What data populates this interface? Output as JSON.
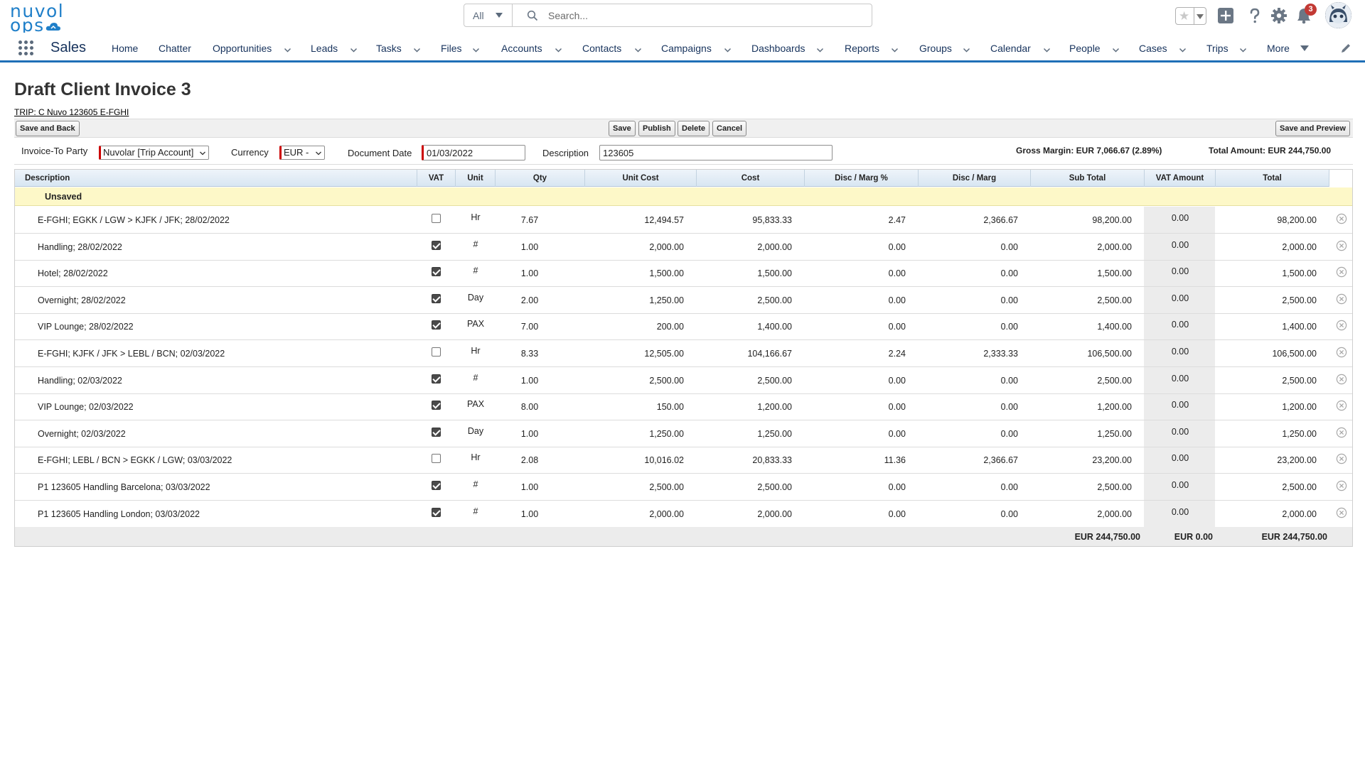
{
  "logo": {
    "line1": "nuvol",
    "line2": "ops"
  },
  "search": {
    "scope": "All",
    "placeholder": "Search..."
  },
  "notifications": {
    "count": "3"
  },
  "nav": {
    "app_name": "Sales",
    "items": [
      {
        "label": "Home",
        "dropdown": false
      },
      {
        "label": "Chatter",
        "dropdown": false
      },
      {
        "label": "Opportunities",
        "dropdown": true
      },
      {
        "label": "Leads",
        "dropdown": true
      },
      {
        "label": "Tasks",
        "dropdown": true
      },
      {
        "label": "Files",
        "dropdown": true
      },
      {
        "label": "Accounts",
        "dropdown": true
      },
      {
        "label": "Contacts",
        "dropdown": true
      },
      {
        "label": "Campaigns",
        "dropdown": true
      },
      {
        "label": "Dashboards",
        "dropdown": true
      },
      {
        "label": "Reports",
        "dropdown": true
      },
      {
        "label": "Groups",
        "dropdown": true
      },
      {
        "label": "Calendar",
        "dropdown": true
      },
      {
        "label": "People",
        "dropdown": true
      },
      {
        "label": "Cases",
        "dropdown": true
      },
      {
        "label": "Trips",
        "dropdown": true
      },
      {
        "label": "More",
        "dropdown": true
      }
    ]
  },
  "page": {
    "title": "Draft Client Invoice 3",
    "trip_link": "TRIP: C Nuvo 123605 E-FGHI"
  },
  "buttons": {
    "save_and_back": "Save and Back",
    "save": "Save",
    "publish": "Publish",
    "delete": "Delete",
    "cancel": "Cancel",
    "save_and_preview": "Save and Preview"
  },
  "fields": {
    "invoice_to_label": "Invoice-To Party",
    "invoice_to_value": "Nuvolar [Trip Account]",
    "currency_label": "Currency",
    "currency_value": "EUR -",
    "doc_date_label": "Document Date",
    "doc_date_value": "01/03/2022",
    "description_label": "Description",
    "description_value": "123605",
    "gross_margin": "Gross Margin: EUR 7,066.67 (2.89%)",
    "total_amount": "Total Amount: EUR 244,750.00"
  },
  "table": {
    "headers": [
      "Description",
      "VAT",
      "Unit",
      "Qty",
      "Unit Cost",
      "Cost",
      "Disc / Marg %",
      "Disc / Marg",
      "Sub Total",
      "VAT Amount",
      "Total"
    ],
    "group_label": "Unsaved",
    "rows": [
      {
        "desc": "E-FGHI; EGKK / LGW > KJFK / JFK; 28/02/2022",
        "vat": false,
        "unit": "Hr",
        "qty": "7.67",
        "unit_cost": "12,494.57",
        "cost": "95,833.33",
        "dm_pct": "2.47",
        "dm": "2,366.67",
        "sub": "98,200.00",
        "vat_amt": "0.00",
        "total": "98,200.00"
      },
      {
        "desc": "Handling; 28/02/2022",
        "vat": true,
        "unit": "#",
        "qty": "1.00",
        "unit_cost": "2,000.00",
        "cost": "2,000.00",
        "dm_pct": "0.00",
        "dm": "0.00",
        "sub": "2,000.00",
        "vat_amt": "0.00",
        "total": "2,000.00"
      },
      {
        "desc": "Hotel; 28/02/2022",
        "vat": true,
        "unit": "#",
        "qty": "1.00",
        "unit_cost": "1,500.00",
        "cost": "1,500.00",
        "dm_pct": "0.00",
        "dm": "0.00",
        "sub": "1,500.00",
        "vat_amt": "0.00",
        "total": "1,500.00"
      },
      {
        "desc": "Overnight; 28/02/2022",
        "vat": true,
        "unit": "Day",
        "qty": "2.00",
        "unit_cost": "1,250.00",
        "cost": "2,500.00",
        "dm_pct": "0.00",
        "dm": "0.00",
        "sub": "2,500.00",
        "vat_amt": "0.00",
        "total": "2,500.00"
      },
      {
        "desc": "VIP Lounge; 28/02/2022",
        "vat": true,
        "unit": "PAX",
        "qty": "7.00",
        "unit_cost": "200.00",
        "cost": "1,400.00",
        "dm_pct": "0.00",
        "dm": "0.00",
        "sub": "1,400.00",
        "vat_amt": "0.00",
        "total": "1,400.00"
      },
      {
        "desc": "E-FGHI; KJFK / JFK > LEBL / BCN; 02/03/2022",
        "vat": false,
        "unit": "Hr",
        "qty": "8.33",
        "unit_cost": "12,505.00",
        "cost": "104,166.67",
        "dm_pct": "2.24",
        "dm": "2,333.33",
        "sub": "106,500.00",
        "vat_amt": "0.00",
        "total": "106,500.00"
      },
      {
        "desc": "Handling; 02/03/2022",
        "vat": true,
        "unit": "#",
        "qty": "1.00",
        "unit_cost": "2,500.00",
        "cost": "2,500.00",
        "dm_pct": "0.00",
        "dm": "0.00",
        "sub": "2,500.00",
        "vat_amt": "0.00",
        "total": "2,500.00"
      },
      {
        "desc": "VIP Lounge; 02/03/2022",
        "vat": true,
        "unit": "PAX",
        "qty": "8.00",
        "unit_cost": "150.00",
        "cost": "1,200.00",
        "dm_pct": "0.00",
        "dm": "0.00",
        "sub": "1,200.00",
        "vat_amt": "0.00",
        "total": "1,200.00"
      },
      {
        "desc": "Overnight; 02/03/2022",
        "vat": true,
        "unit": "Day",
        "qty": "1.00",
        "unit_cost": "1,250.00",
        "cost": "1,250.00",
        "dm_pct": "0.00",
        "dm": "0.00",
        "sub": "1,250.00",
        "vat_amt": "0.00",
        "total": "1,250.00"
      },
      {
        "desc": "E-FGHI; LEBL / BCN > EGKK / LGW; 03/03/2022",
        "vat": false,
        "unit": "Hr",
        "qty": "2.08",
        "unit_cost": "10,016.02",
        "cost": "20,833.33",
        "dm_pct": "11.36",
        "dm": "2,366.67",
        "sub": "23,200.00",
        "vat_amt": "0.00",
        "total": "23,200.00"
      },
      {
        "desc": "P1 123605 Handling Barcelona; 03/03/2022",
        "vat": true,
        "unit": "#",
        "qty": "1.00",
        "unit_cost": "2,500.00",
        "cost": "2,500.00",
        "dm_pct": "0.00",
        "dm": "0.00",
        "sub": "2,500.00",
        "vat_amt": "0.00",
        "total": "2,500.00"
      },
      {
        "desc": "P1 123605 Handling London; 03/03/2022",
        "vat": true,
        "unit": "#",
        "qty": "1.00",
        "unit_cost": "2,000.00",
        "cost": "2,000.00",
        "dm_pct": "0.00",
        "dm": "0.00",
        "sub": "2,000.00",
        "vat_amt": "0.00",
        "total": "2,000.00"
      }
    ],
    "totals": {
      "sub": "EUR 244,750.00",
      "vat": "EUR 0.00",
      "total": "EUR 244,750.00"
    }
  },
  "colors": {
    "brand": "#1f7fc9",
    "nav_underline": "#1f6fb7",
    "badge": "#c23934",
    "group_row": "#fdf8c8",
    "required": "#cc0000"
  },
  "icons": [
    "search-icon",
    "star-icon",
    "add-icon",
    "help-icon",
    "gear-icon",
    "bell-icon",
    "app-launcher-icon",
    "chevron-down-icon",
    "pencil-icon",
    "remove-icon"
  ]
}
